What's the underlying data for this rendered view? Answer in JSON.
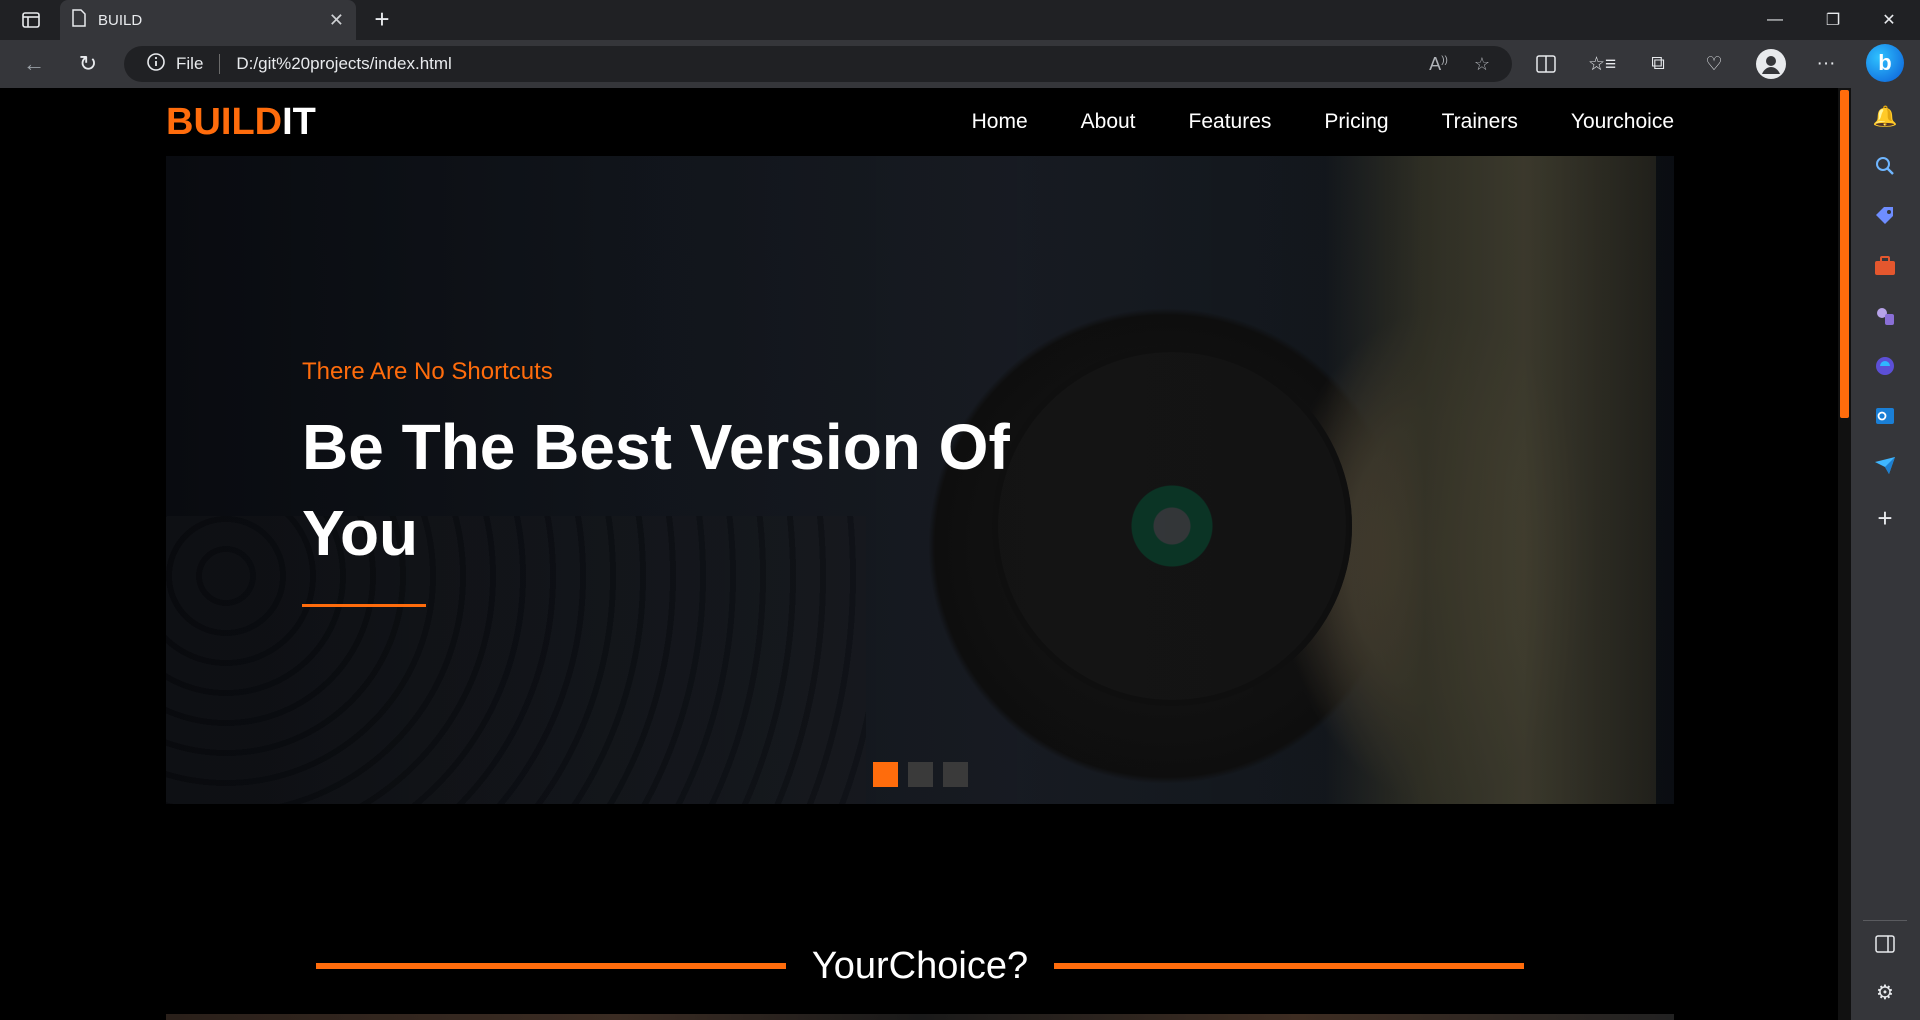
{
  "browser": {
    "tab_title": "BUILD",
    "address_prefix": "File",
    "url": "D:/git%20projects/index.html"
  },
  "site": {
    "logo_part1": "BUILD",
    "logo_part2": "IT",
    "nav": [
      "Home",
      "About",
      "Features",
      "Pricing",
      "Trainers",
      "Yourchoice"
    ]
  },
  "hero": {
    "tagline": "There Are No Shortcuts",
    "headline": "Be The Best Version Of You",
    "slides": 3,
    "active_slide": 1
  },
  "section": {
    "title": "YourChoice?"
  },
  "colors": {
    "accent": "#ff6c0c",
    "background": "#000000"
  }
}
